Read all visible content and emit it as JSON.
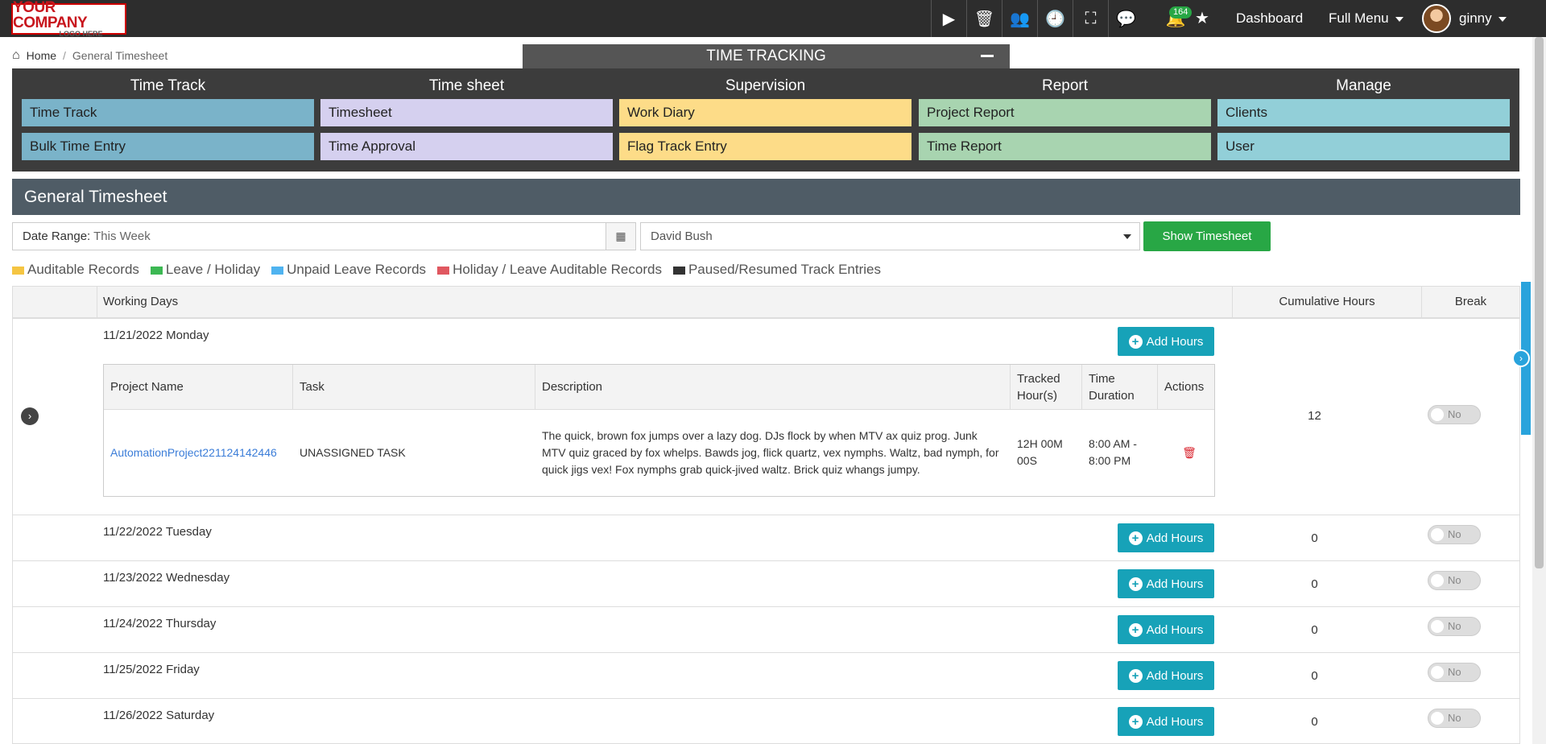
{
  "header": {
    "logo_line1": "YOUR COMPANY",
    "logo_line2": "LOGO HERE",
    "notification_count": "164",
    "dashboard": "Dashboard",
    "full_menu": "Full Menu",
    "user": "ginny"
  },
  "breadcrumb": {
    "home": "Home",
    "sep": "/",
    "current": "General Timesheet"
  },
  "time_tracking": {
    "title": "TIME TRACKING",
    "columns": [
      {
        "heading": "Time Track",
        "items": [
          "Time Track",
          "Bulk Time Entry"
        ]
      },
      {
        "heading": "Time sheet",
        "items": [
          "Timesheet",
          "Time Approval"
        ]
      },
      {
        "heading": "Supervision",
        "items": [
          "Work Diary",
          "Flag Track Entry"
        ]
      },
      {
        "heading": "Report",
        "items": [
          "Project Report",
          "Time Report"
        ]
      },
      {
        "heading": "Manage",
        "items": [
          "Clients",
          "User"
        ]
      }
    ]
  },
  "section_title": "General Timesheet",
  "filters": {
    "date_label": "Date Range:",
    "date_value": "This Week",
    "employee": "David Bush",
    "show_button": "Show Timesheet"
  },
  "legend": [
    {
      "label": "Auditable Records",
      "color": "#f5c542"
    },
    {
      "label": "Leave / Holiday",
      "color": "#3cb853"
    },
    {
      "label": "Unpaid Leave Records",
      "color": "#4fb3f0"
    },
    {
      "label": "Holiday / Leave Auditable Records",
      "color": "#e05860"
    },
    {
      "label": "Paused/Resumed Track Entries",
      "color": "#333333"
    }
  ],
  "table": {
    "headers": {
      "working_days": "Working Days",
      "cumulative": "Cumulative Hours",
      "break": "Break"
    },
    "add_hours": "Add Hours",
    "toggle_label": "No",
    "inner_headers": {
      "project": "Project Name",
      "task": "Task",
      "description": "Description",
      "tracked": "Tracked Hour(s)",
      "duration": "Time Duration",
      "actions": "Actions"
    },
    "entry": {
      "project": "AutomationProject221124142446",
      "task": "UNASSIGNED TASK",
      "description": "The quick, brown fox jumps over a lazy dog. DJs flock by when MTV ax quiz prog. Junk MTV quiz graced by fox whelps. Bawds jog, flick quartz, vex nymphs. Waltz, bad nymph, for quick jigs vex! Fox nymphs grab quick-jived waltz. Brick quiz whangs jumpy.",
      "tracked": "12H 00M 00S",
      "duration": "8:00 AM - 8:00 PM"
    },
    "days": [
      {
        "date": "11/21/2022 Monday",
        "hours": "12"
      },
      {
        "date": "11/22/2022 Tuesday",
        "hours": "0"
      },
      {
        "date": "11/23/2022 Wednesday",
        "hours": "0"
      },
      {
        "date": "11/24/2022 Thursday",
        "hours": "0"
      },
      {
        "date": "11/25/2022 Friday",
        "hours": "0"
      },
      {
        "date": "11/26/2022 Saturday",
        "hours": "0"
      }
    ]
  }
}
